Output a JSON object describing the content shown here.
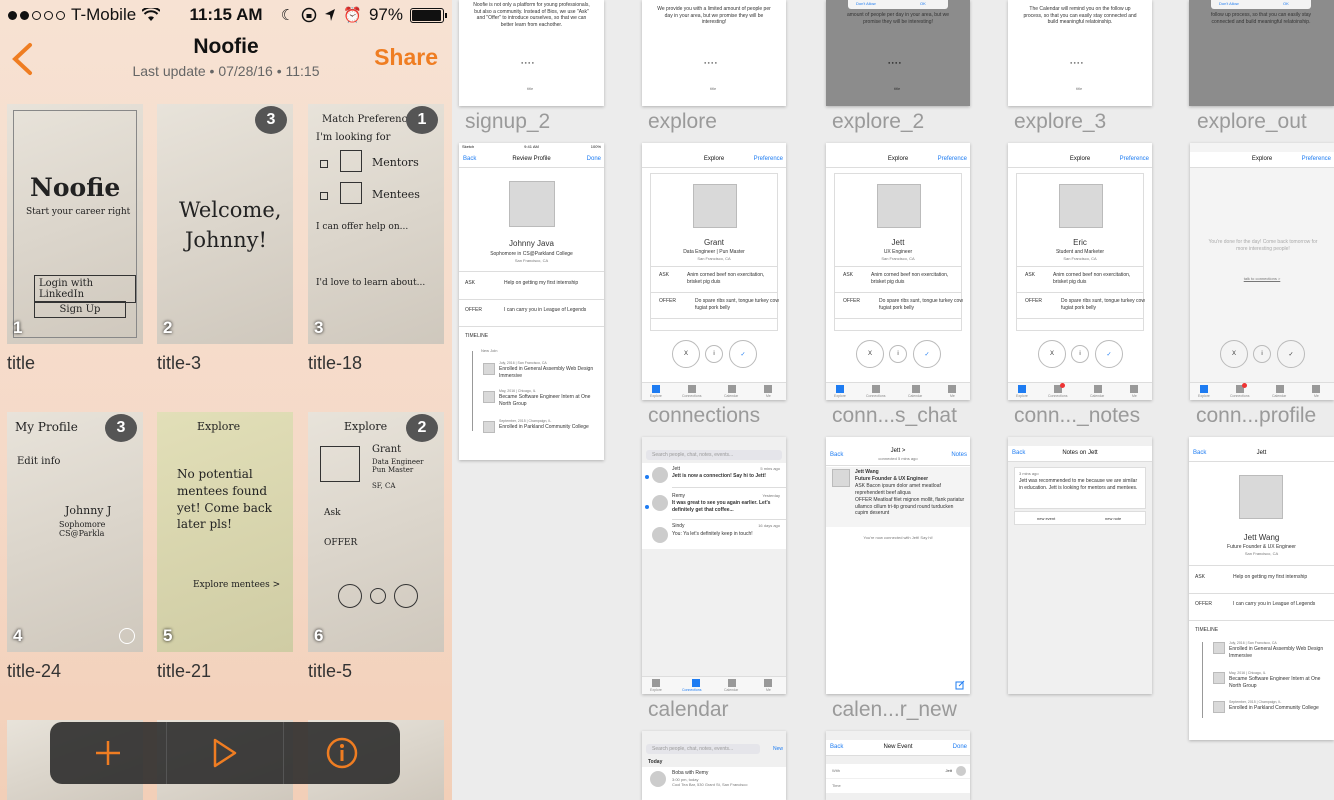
{
  "status_bar": {
    "carrier": "T-Mobile",
    "time": "11:15 AM",
    "battery": "97%",
    "battery_level": 0.97
  },
  "nav": {
    "title": "Noofie",
    "subtitle": "Last update • 07/28/16 • 11:15",
    "share": "Share"
  },
  "thumbs": [
    {
      "num": "1",
      "label": "title",
      "badge": ""
    },
    {
      "num": "2",
      "label": "title-3",
      "badge": "3"
    },
    {
      "num": "3",
      "label": "title-18",
      "badge": "1"
    },
    {
      "num": "4",
      "label": "title-24",
      "badge": "3"
    },
    {
      "num": "5",
      "label": "title-21",
      "badge": ""
    },
    {
      "num": "6",
      "label": "title-5",
      "badge": "2"
    }
  ],
  "sketch_text": {
    "t1_title": "Noofie",
    "t1_sub": "Start your career right",
    "t1_btn1": "Login with LinkedIn",
    "t1_btn2": "Sign Up",
    "t2_line1": "Welcome,",
    "t2_line2": "Johnny!",
    "t3_header": "Match Preference",
    "t3_look": "I'm looking for",
    "t3_opt1": "Mentors",
    "t3_opt2": "Mentees",
    "t3_help": "I can offer help on...",
    "t3_learn": "I'd love to learn about...",
    "t4_header": "My Profile",
    "t4_edit": "Edit info",
    "t4_name": "Johnny J",
    "t4_sub": "Sophomore CS@Parkla",
    "t5_header": "Explore",
    "t5_text": "No potential mentees found yet! Come back later pls!",
    "t5_link": "Explore mentees >",
    "t6_header": "Explore",
    "t6_name": "Grant",
    "t6_role": "Data Engineer Pun Master",
    "t6_loc": "SF, CA",
    "t6_ask": "Ask",
    "t6_offer": "OFFER"
  },
  "toolbar": {
    "add_icon": "plus-icon",
    "play_icon": "play-icon",
    "info_icon": "info-icon"
  },
  "artboards": {
    "row0": [
      {
        "label": "signup_2",
        "text": "Noofie is not only a platform for young professionals, but also a community. Instead of Bios, we use \"Ask\" and \"Offer\" to introduce ourselves, so that we can better learn from eachother."
      },
      {
        "label": "explore",
        "text": "We provide you with a limited amount of people per day in your area, but we promise they will be interesting!"
      },
      {
        "label": "explore_2",
        "text": "amount of people per day in your area, but we promise they will be interesting!",
        "dialog_left": "Don't Allow",
        "dialog_right": "OK"
      },
      {
        "label": "explore_3",
        "text": "The Calendar will remind you on the follow up process, so that you can easily stay connected and build meaningful relatoinship."
      },
      {
        "label": "explore_out",
        "text": "follow up process, so that you can easily stay connected and build meaningful relatoinship.",
        "dialog_left": "Don't Allow",
        "dialog_right": "OK"
      }
    ],
    "slides_label": "title",
    "review_profile": {
      "status_left": "Sketch",
      "status_time": "9:41 AM",
      "status_right": "100%",
      "back": "Back",
      "title": "Review Profile",
      "done": "Done",
      "name": "Johnny Java",
      "sub": "Sophomore in CS@Parkland College",
      "loc": "San Francisco, CA",
      "ask_label": "ASK",
      "ask": "Help on getting my first internship",
      "offer_label": "OFFER",
      "offer": "I can carry you in League of Legends",
      "timeline_label": "TIMELINE",
      "timeline_now": "New Join",
      "timeline": [
        {
          "meta": "July, 2016 | San Francisco, CA",
          "text": "Enrolled in General Assembly Web Design Immersive"
        },
        {
          "meta": "May, 2016 | Chicago, IL",
          "text": "Became Software Engineer Intern at One North Group"
        },
        {
          "meta": "September, 2015 | Champaign, IL",
          "text": "Enrolled in Parkland Community College"
        }
      ]
    },
    "explore_cards": [
      {
        "label": "connections",
        "name": "Grant",
        "role": "Data Engineer | Pun Master",
        "loc": "San Francisco, CA",
        "badge": ""
      },
      {
        "label": "conn...s_chat",
        "name": "Jett",
        "role": "UX Engineer",
        "loc": "San Francisco, CA",
        "badge": ""
      },
      {
        "label": "conn..._notes",
        "name": "Eric",
        "role": "Student and Marketer",
        "loc": "San Francisco, CA",
        "badge": "1"
      }
    ],
    "explore_common": {
      "title": "Explore",
      "pref": "Preference",
      "ask_label": "ASK",
      "ask": "Anim corned beef non exercitation, brisket pig duis",
      "offer_label": "OFFER",
      "offer": "Do spare ribs sunt, tongue turkey cow fugiat pork belly",
      "btn_x": "X",
      "btn_i": "i",
      "btn_check": "✓",
      "tabs": [
        "Explore",
        "Connections",
        "Calendar",
        "Me"
      ]
    },
    "done_screen": {
      "label": "conn...profile",
      "text": "You're done for the day! Come back tomorrow for more interesting people!",
      "link": "talk to connections >",
      "badge": "1"
    },
    "calendar": {
      "label": "calendar",
      "search": "Search people, chat, notes, events...",
      "items": [
        {
          "name": "Jett",
          "time": "5 mins ago",
          "msg": "Jett is now a connection! Say hi to Jett!"
        },
        {
          "name": "Remy",
          "time": "Yesterday",
          "msg": "It was great to see you again earlier. Let's definitely get that coffee..."
        },
        {
          "name": "Sindy",
          "time": "16 days ago",
          "msg": "You: Ya let's definitely keep in touch!"
        }
      ]
    },
    "chat": {
      "label": "calen...r_new",
      "back": "Back",
      "title": "Jett >",
      "sub": "connected 5 mins ago",
      "notes": "Notes",
      "name": "Jett Wang",
      "role": "Future Founder & UX Engineer",
      "ask": "ASK Bacon ipsum dolor amet meatloaf reprehenderit beef aliqua",
      "offer": "OFFER Meatloaf filet mignon mollit, flank pariatur ullamco cillum tri-tip ground round turducken cupim deserunt",
      "system": "You're now connected with Jett! Say hi!"
    },
    "notes": {
      "back": "Back",
      "title": "Notes on Jett",
      "time": "3 mins ago",
      "text": "Jett was recommended to me because we are similar in education. Jett is looking for mentors and mentees.",
      "btn1": "new event",
      "btn2": "new note"
    },
    "profile": {
      "back": "Back",
      "title": "Jett",
      "name": "Jett Wang",
      "role": "Future Founder & UX Engineer",
      "loc": "San Francisco, CA",
      "ask_label": "ASK",
      "ask": "Help on getting my first internship",
      "offer_label": "OFFER",
      "offer": "I can carry you in League of Legends",
      "timeline_label": "TIMELINE"
    },
    "bottom": {
      "search": "Search people, chat, notes, events...",
      "new": "New",
      "today": "Today",
      "event_title": "Boba with Remy",
      "event_time": "3:00 pm, today",
      "event_loc": "Cool Tea Bar, 530 Grant St, San Francisco",
      "back": "Back",
      "new_event": "New Event",
      "done": "Done",
      "with_label": "With",
      "with_value": "Jett",
      "time_label": "Time"
    }
  },
  "colors": {
    "accent": "#ef7d22",
    "ios_blue": "#1e7cf2"
  }
}
